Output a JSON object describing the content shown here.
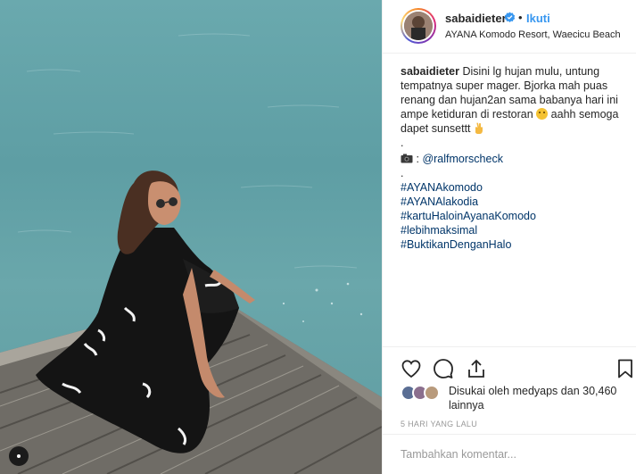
{
  "header": {
    "username": "sabaidieter",
    "separator": "•",
    "follow_label": "Ikuti",
    "location": "AYANA Komodo Resort, Waecicu Beach"
  },
  "caption": {
    "username": "sabaidieter",
    "text_1": "Disini lg hujan mulu, untung tempatnya super mager. Bjorka mah puas renang dan hujan2an sama babanya hari ini ampe ketiduran di restoran",
    "text_2": "aahh semoga dapet sunsettt",
    "dot_1": ".",
    "credit_prefix": ":",
    "credit_mention": "@ralfmorscheck",
    "dot_2": ".",
    "hashtags": [
      "#AYANAkomodo",
      "#AYANAlakodia",
      "#kartuHaloinAyanaKomodo",
      "#lebihmaksimal",
      "#BuktikanDenganHalo"
    ]
  },
  "icons": {
    "like": "heart-icon",
    "comment": "speech-bubble-icon",
    "share": "share-icon",
    "save": "bookmark-icon",
    "verified": "verified-badge-icon",
    "more": "ellipsis-icon"
  },
  "likes": {
    "prefix": "Disukai oleh",
    "user": "medyaps",
    "conjunction": "dan",
    "count": "30,460",
    "suffix": "lainnya"
  },
  "timestamp": "5 HARI YANG LALU",
  "comment_input": {
    "placeholder": "Tambahkan komentar..."
  },
  "colors": {
    "link": "#003569",
    "follow": "#3897f0",
    "verified": "#3897f0",
    "water": "#62a3a8"
  }
}
